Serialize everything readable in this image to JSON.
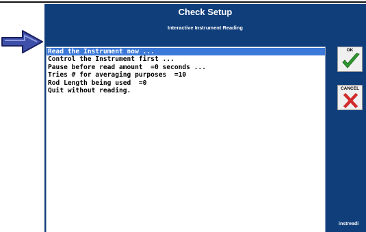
{
  "window": {
    "title": "Check Setup",
    "subtitle": "Interactive Instrument Reading"
  },
  "menu": {
    "items": [
      "Read the Instrument now ...",
      "Control the Instrument first ...",
      "Pause before read amount  =0 seconds ...",
      "Tries # for averaging purposes  =10",
      "Rod Length being used  =0",
      "Quit without reading."
    ],
    "selected_index": 0
  },
  "buttons": {
    "ok_label": "OK",
    "cancel_label": "CANCEL"
  },
  "footer": {
    "text": "instreadi"
  },
  "colors": {
    "background": "#0f3e7a",
    "selection": "#3b78d8",
    "ok_check": "#2f9a2f",
    "cancel_x": "#d12b2b",
    "pointer_arrow": "#3d4fa8"
  },
  "icons": {
    "pointer": "right-arrow-icon",
    "ok": "checkmark-icon",
    "cancel": "x-icon"
  }
}
